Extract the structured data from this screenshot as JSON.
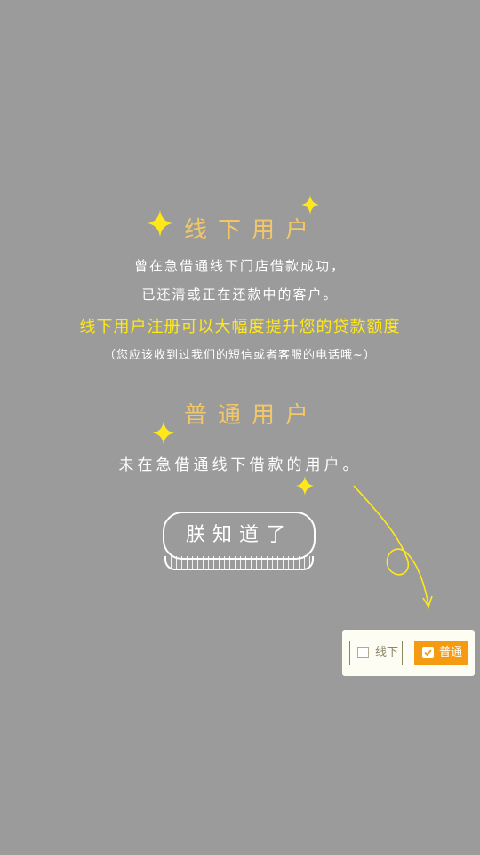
{
  "offline_section": {
    "title": "线下用户",
    "line1": "曾在急借通线下门店借款成功，",
    "line2": "已还清或正在还款中的客户。",
    "highlight": "线下用户注册可以大幅度提升您的贷款额度",
    "note": "（您应该收到过我们的短信或者客服的电话哦~）"
  },
  "normal_section": {
    "title": "普通用户",
    "line1": "未在急借通线下借款的用户。"
  },
  "ok_button": {
    "label": "朕知道了"
  },
  "selector": {
    "options": [
      {
        "label": "线下",
        "checked": false
      },
      {
        "label": "普通",
        "checked": true
      }
    ]
  },
  "colors": {
    "background": "#9b9b9b",
    "heading": "#f2c768",
    "highlight": "#ffe81a",
    "accent": "#f59b12"
  }
}
